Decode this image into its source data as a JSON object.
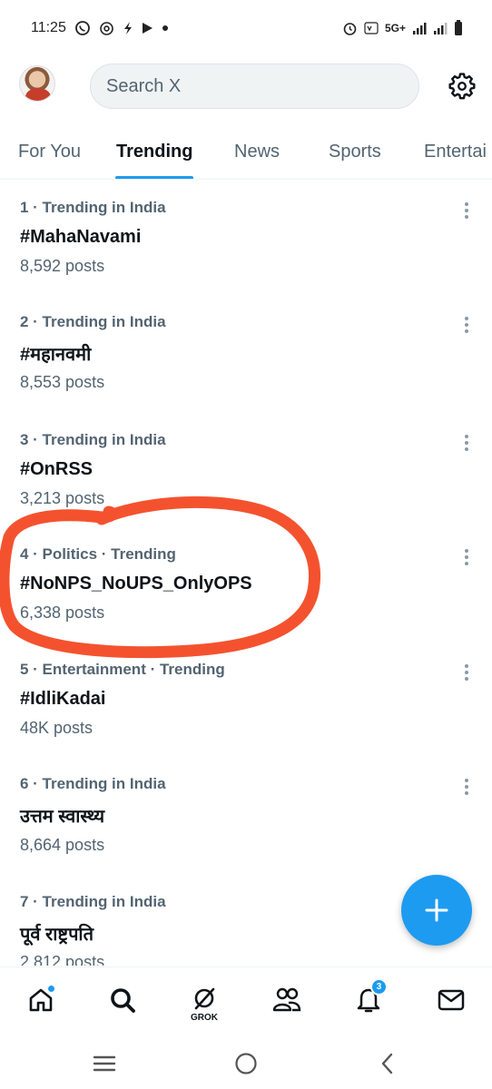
{
  "status_bar": {
    "time": "11:25",
    "network": "5G+"
  },
  "search": {
    "placeholder": "Search X"
  },
  "tabs": [
    {
      "label": "For You"
    },
    {
      "label": "Trending"
    },
    {
      "label": "News"
    },
    {
      "label": "Sports"
    },
    {
      "label": "Entertai"
    }
  ],
  "trends": [
    {
      "meta": "1 · Trending in India",
      "name": "#MahaNavami",
      "count": "8,592 posts"
    },
    {
      "meta": "2 · Trending in India",
      "name": "#महानवमी",
      "count": "8,553 posts"
    },
    {
      "meta": "3 · Trending in India",
      "name": "#OnRSS",
      "count": "3,213 posts"
    },
    {
      "meta": "4 · Politics · Trending",
      "name": "#NoNPS_NoUPS_OnlyOPS",
      "count": "6,338 posts"
    },
    {
      "meta": "5 · Entertainment · Trending",
      "name": "#IdliKadai",
      "count": "48K posts"
    },
    {
      "meta": "6 · Trending in India",
      "name": "उत्तम स्वास्थ्य",
      "count": "8,664 posts"
    },
    {
      "meta": "7 · Trending in India",
      "name": "पूर्व राष्ट्रपति",
      "count": "2,812 posts"
    }
  ],
  "bottom_nav": {
    "grok_label": "GROK",
    "notification_count": "3"
  },
  "colors": {
    "accent": "#1d9bf0",
    "annotation": "#f4522f",
    "secondary_text": "#536471"
  }
}
